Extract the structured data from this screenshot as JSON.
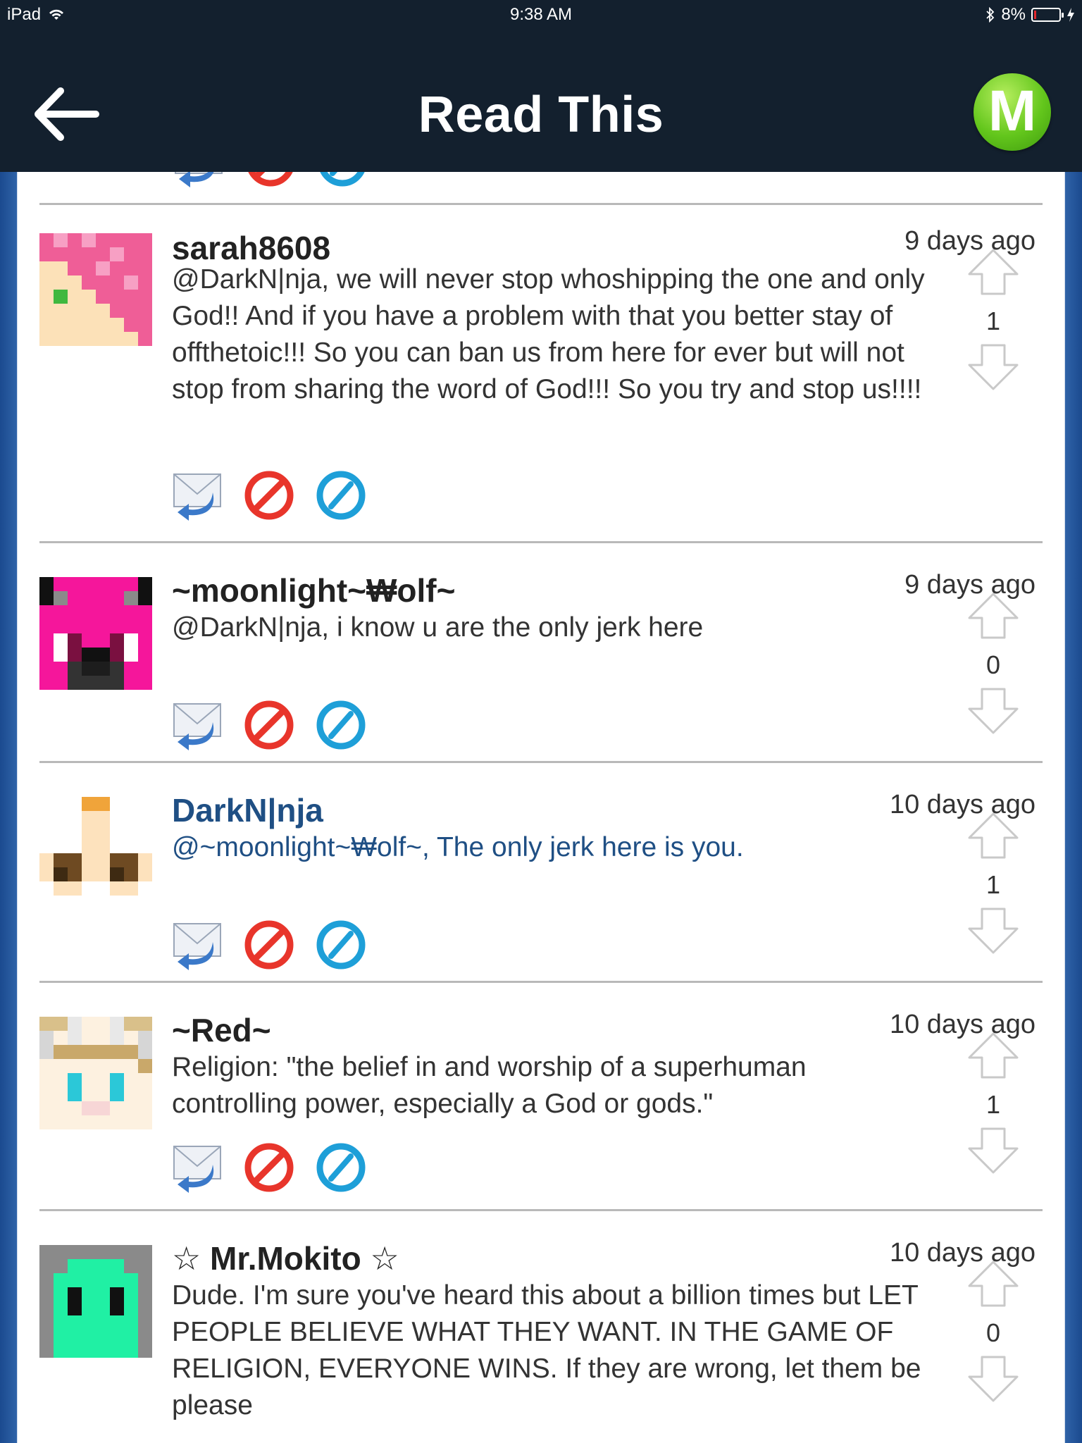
{
  "status_bar": {
    "device": "iPad",
    "time": "9:38 AM",
    "battery": "8%"
  },
  "nav": {
    "title": "Read This",
    "logo_letter": "M"
  },
  "comments": [
    {
      "username": "sarah8608",
      "timestamp": "9 days ago",
      "text": "@DarkN|nja, we will never stop whoshipping the one and only God!! And if you have a problem with that you better stay of offthetoic!!! So you can ban us from here for ever but will not stop from sharing the word of God!!! So you try and stop us!!!!",
      "votes": "1"
    },
    {
      "username": "~moonlight~₩olf~",
      "timestamp": "9 days ago",
      "text": "@DarkN|nja, i know u are the only jerk here",
      "votes": "0"
    },
    {
      "username": "DarkN|nja",
      "timestamp": "10 days ago",
      "text": "@~moonlight~₩olf~, The only jerk here is you.",
      "votes": "1"
    },
    {
      "username": "~Red~",
      "timestamp": "10 days ago",
      "text": "Religion: \"the belief in and worship of a superhuman controlling power, especially a God or gods.\"",
      "votes": "1"
    },
    {
      "username": "☆ Mr.Mokito ☆",
      "timestamp": "10 days ago",
      "text": "Dude. I'm sure you've heard this about a billion times but LET PEOPLE BELIEVE WHAT THEY WANT. IN THE GAME OF RELIGION, EVERYONE WINS. If they are wrong, let them be please",
      "votes": "0"
    }
  ],
  "icons": {
    "reply": "reply-mail-icon",
    "block": "block-icon",
    "report": "report-icon",
    "upvote": "up-arrow-icon",
    "downvote": "down-arrow-icon"
  },
  "colors": {
    "nav_background": "#13202e",
    "highlight_blue": "#1f4f84",
    "logo_green": "#63c61c",
    "block_red": "#e8352b",
    "report_blue": "#1e9fd8"
  }
}
